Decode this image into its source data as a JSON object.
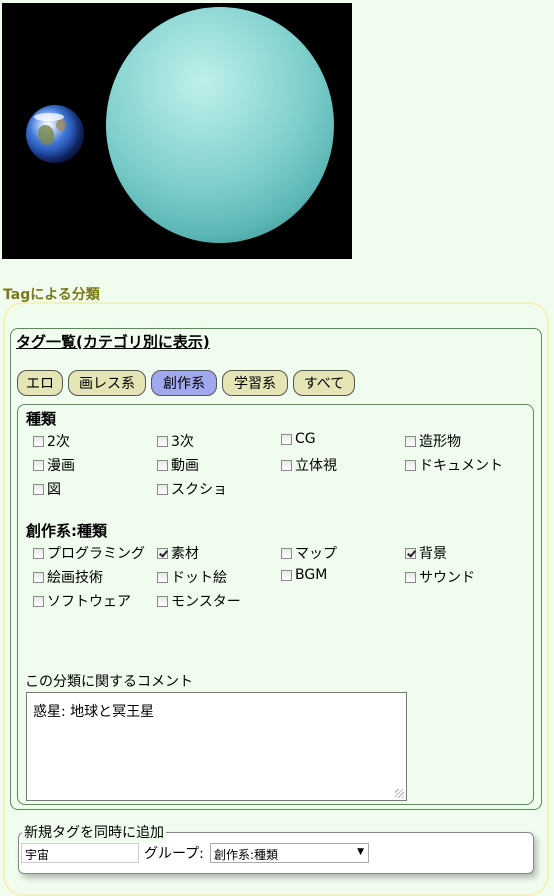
{
  "section_title": "Tagによる分類",
  "panel_title": "タグ一覧(カテゴリ別に表示)",
  "tabs": [
    {
      "label": "エロ",
      "active": false
    },
    {
      "label": "画レス系",
      "active": false
    },
    {
      "label": "創作系",
      "active": true
    },
    {
      "label": "学習系",
      "active": false
    },
    {
      "label": "すべて",
      "active": false
    }
  ],
  "groups": [
    {
      "title": "種類",
      "items": [
        {
          "label": "2次",
          "checked": false
        },
        {
          "label": "3次",
          "checked": false
        },
        {
          "label": "CG",
          "checked": false
        },
        {
          "label": "造形物",
          "checked": false
        },
        {
          "label": "漫画",
          "checked": false
        },
        {
          "label": "動画",
          "checked": false
        },
        {
          "label": "立体視",
          "checked": false
        },
        {
          "label": "ドキュメント",
          "checked": false
        },
        {
          "label": "図",
          "checked": false
        },
        {
          "label": "スクショ",
          "checked": false
        }
      ]
    },
    {
      "title": "創作系:種類",
      "items": [
        {
          "label": "プログラミング",
          "checked": false
        },
        {
          "label": "素材",
          "checked": true
        },
        {
          "label": "マップ",
          "checked": false
        },
        {
          "label": "背景",
          "checked": true
        },
        {
          "label": "絵画技術",
          "checked": false
        },
        {
          "label": "ドット絵",
          "checked": false
        },
        {
          "label": "BGM",
          "checked": false
        },
        {
          "label": "サウンド",
          "checked": false
        },
        {
          "label": "ソフトウェア",
          "checked": false
        },
        {
          "label": "モンスター",
          "checked": false
        }
      ]
    }
  ],
  "comment": {
    "label": "この分類に関するコメント",
    "value": "惑星: 地球と冥王星"
  },
  "new_tag": {
    "legend": "新規タグを同時に追加",
    "input_value": "宇宙",
    "group_label": "グループ:",
    "group_selected": "創作系:種類"
  },
  "colors": {
    "page_bg": "#f0fcee",
    "heading": "#7a7a18",
    "tab_bg": "#e4e4b4",
    "tab_active_bg": "#a0a8f0"
  }
}
